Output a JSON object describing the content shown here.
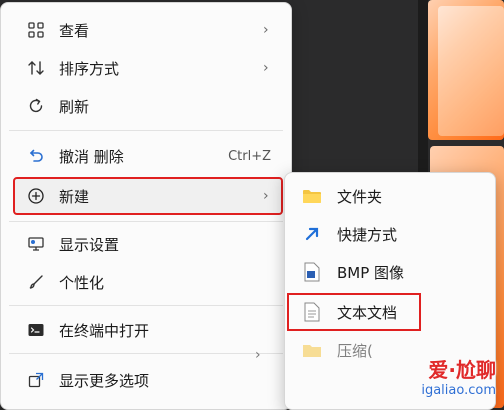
{
  "menu": {
    "items": [
      {
        "label": "查看",
        "icon": "grid-icon",
        "has_submenu": true
      },
      {
        "label": "排序方式",
        "icon": "sort-arrows-icon",
        "has_submenu": true
      },
      {
        "label": "刷新",
        "icon": "refresh-icon",
        "has_submenu": false
      },
      {
        "label": "撤消 删除",
        "icon": "undo-icon",
        "shortcut": "Ctrl+Z"
      },
      {
        "label": "新建",
        "icon": "add-circle-icon",
        "has_submenu": true,
        "highlighted": true
      },
      {
        "label": "显示设置",
        "icon": "display-icon"
      },
      {
        "label": "个性化",
        "icon": "brush-icon"
      },
      {
        "label": "在终端中打开",
        "icon": "terminal-icon"
      },
      {
        "label": "显示更多选项",
        "icon": "more-options-icon"
      }
    ]
  },
  "submenu": {
    "items": [
      {
        "label": "文件夹",
        "icon": "folder-icon"
      },
      {
        "label": "快捷方式",
        "icon": "shortcut-arrow-icon"
      },
      {
        "label": "BMP 图像",
        "icon": "bmp-image-icon"
      },
      {
        "label": "文本文档",
        "icon": "text-document-icon",
        "highlighted": true
      },
      {
        "label": "压缩(",
        "icon": "zip-folder-icon"
      }
    ]
  },
  "watermark": {
    "main": "爱·尬聊",
    "sub": "igaliao.com"
  },
  "colors": {
    "highlight_border": "#e02020",
    "menu_bg": "#fbfbfb",
    "accent": "#0067c0"
  }
}
